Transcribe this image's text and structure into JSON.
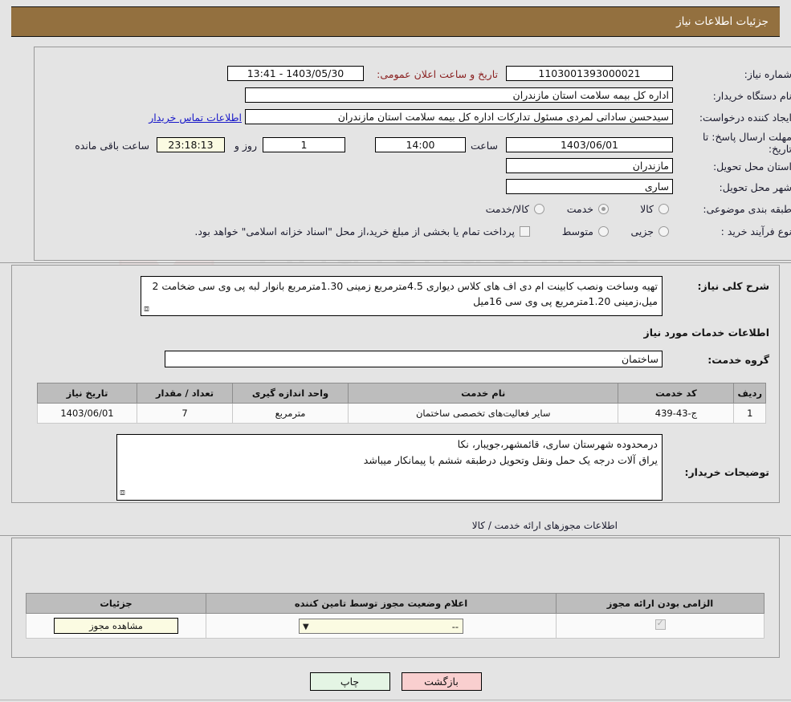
{
  "header": {
    "title": "جزئیات اطلاعات نیاز"
  },
  "form": {
    "need_number_label": "شماره نیاز:",
    "need_number_value": "1103001393000021",
    "public_announce_label": "تاریخ و ساعت اعلان عمومی:",
    "public_announce_value": "1403/05/30 - 13:41",
    "buyer_org_label": "نام دستگاه خریدار:",
    "buyer_org_value": "اداره کل بیمه سلامت استان مازندران",
    "creator_label": "ایجاد کننده درخواست:",
    "creator_value": "سیدحسن ساداتی لمردی مسئول تدارکات اداره کل بیمه سلامت استان مازندران",
    "contact_link": "اطلاعات تماس خریدار",
    "deadline_label": "مهلت ارسال پاسخ: تا تاریخ:",
    "deadline_date": "1403/06/01",
    "hour_label": "ساعت",
    "deadline_time": "14:00",
    "days_value": "1",
    "days_label": "روز و",
    "countdown_value": "23:18:13",
    "countdown_label": "ساعت باقی مانده",
    "province_label": "استان محل تحویل:",
    "province_value": "مازندران",
    "city_label": "شهر محل تحویل:",
    "city_value": "ساری",
    "category_label": "طبقه بندی موضوعی:",
    "category_options": [
      {
        "label": "کالا",
        "selected": false
      },
      {
        "label": "خدمت",
        "selected": true
      },
      {
        "label": "کالا/خدمت",
        "selected": false
      }
    ],
    "process_label": "نوع فرآیند خرید :",
    "process_options": [
      {
        "label": "جزیی",
        "selected": false
      },
      {
        "label": "متوسط",
        "selected": false
      }
    ],
    "treasury_checked": false,
    "treasury_text": "پرداخت تمام یا بخشی از مبلغ خرید،از محل \"اسناد خزانه اسلامی\" خواهد بود."
  },
  "description": {
    "label": "شرح کلی نیاز:",
    "value": "تهیه وساخت ونصب کابینت ام دی اف های کلاس دیواری 4.5مترمربع زمینی 1.30مترمربع بانوار لبه پی وی سی ضخامت 2 میل،زمینی 1.20مترمربع پی وی سی 16میل"
  },
  "services": {
    "section_title": "اطلاعات خدمات مورد نیاز",
    "group_label": "گروه خدمت:",
    "group_value": "ساختمان",
    "columns": [
      "ردیف",
      "کد خدمت",
      "نام خدمت",
      "واحد اندازه گیری",
      "تعداد / مقدار",
      "تاریخ نیاز"
    ],
    "rows": [
      {
        "row": "1",
        "code": "ج-43-439",
        "name": "سایر فعالیت‌های تخصصی ساختمان",
        "unit": "مترمربع",
        "qty": "7",
        "date": "1403/06/01"
      }
    ]
  },
  "buyer_notes": {
    "label": "توضیحات خریدار:",
    "value": "درمحدوده شهرستان ساری، قائمشهر،جویبار، نکا\nیراق آلات درجه یک   حمل ونقل وتحویل درطبقه ششم  با پیمانکار میباشد"
  },
  "permits": {
    "section_title": "اطلاعات مجوزهای ارائه خدمت / کالا",
    "columns": [
      "الزامی بودن ارائه مجوز",
      "اعلام وضعیت مجوز توسط تامین کننده",
      "جزئیات"
    ],
    "rows": [
      {
        "required": true,
        "status_value": "--",
        "details_label": "مشاهده مجوز"
      }
    ]
  },
  "footer": {
    "print_label": "چاپ",
    "back_label": "بازگشت"
  }
}
